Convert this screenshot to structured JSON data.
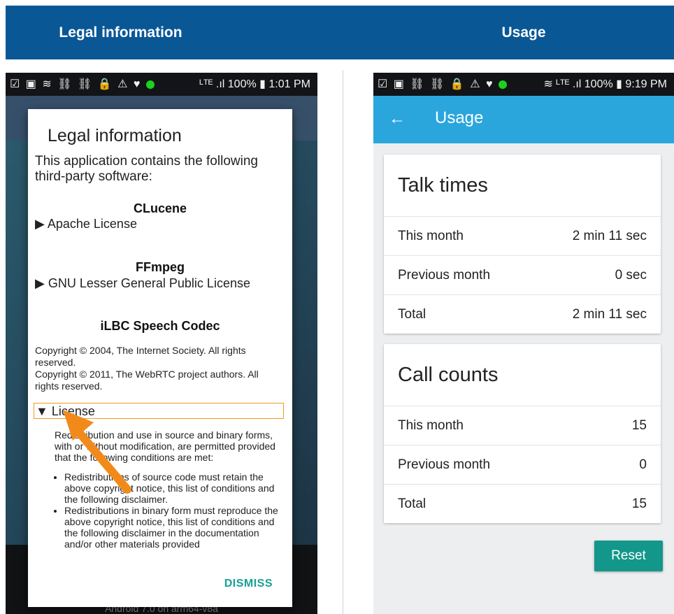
{
  "headers": {
    "left": "Legal information",
    "right": "Usage"
  },
  "left_phone": {
    "status_bar": {
      "icons": "☑ ▣ ≋ ⛓ ⛓ 🔒 ⚠ ♥",
      "network": "ᴸᵀᴱ .ıl",
      "battery": "100%",
      "time": "1:01 PM"
    },
    "footer_text": "Android 7.0 on arm64-v8a",
    "dialog": {
      "title": "Legal information",
      "intro": "This application contains the following third-party software:",
      "libraries": [
        {
          "name": "CLucene",
          "license": "Apache License"
        },
        {
          "name": "FFmpeg",
          "license": "GNU Lesser General Public License"
        },
        {
          "name": "iLBC Speech Codec"
        }
      ],
      "copyright": [
        "Copyright © 2004, The Internet Society. All rights reserved.",
        "Copyright © 2011, The WebRTC project authors. All rights reserved."
      ],
      "license_toggle": "License",
      "license_intro": "Redistribution and use in source and binary forms, with or without modification, are permitted provided that the following conditions are met:",
      "license_items": [
        "Redistributions of source code must retain the above copyright notice, this list of conditions and the following disclaimer.",
        "Redistributions in binary form must reproduce the above copyright notice, this list of conditions and the following disclaimer in the documentation and/or other materials provided"
      ],
      "dismiss": "DISMISS"
    },
    "highlight_color": "#f28a1b"
  },
  "right_phone": {
    "status_bar": {
      "icons": "☑ ▣ ⛓ ⛓ 🔒 ⚠ ♥",
      "network": "ᴸᵀᴱ .ıl",
      "battery": "100%",
      "time": "9:19 PM"
    },
    "app_bar": {
      "back_icon": "arrow-left",
      "title": "Usage"
    },
    "talk_times": {
      "title": "Talk times",
      "rows": [
        {
          "label": "This month",
          "value": "2 min 11 sec"
        },
        {
          "label": "Previous month",
          "value": "0 sec"
        },
        {
          "label": "Total",
          "value": "2 min 11 sec"
        }
      ]
    },
    "call_counts": {
      "title": "Call counts",
      "rows": [
        {
          "label": "This month",
          "value": "15"
        },
        {
          "label": "Previous month",
          "value": "0"
        },
        {
          "label": "Total",
          "value": "15"
        }
      ]
    },
    "reset": "Reset",
    "colors": {
      "app_bar": "#2aa6dd",
      "reset_button": "#13978a",
      "header": "#0a5796"
    }
  }
}
